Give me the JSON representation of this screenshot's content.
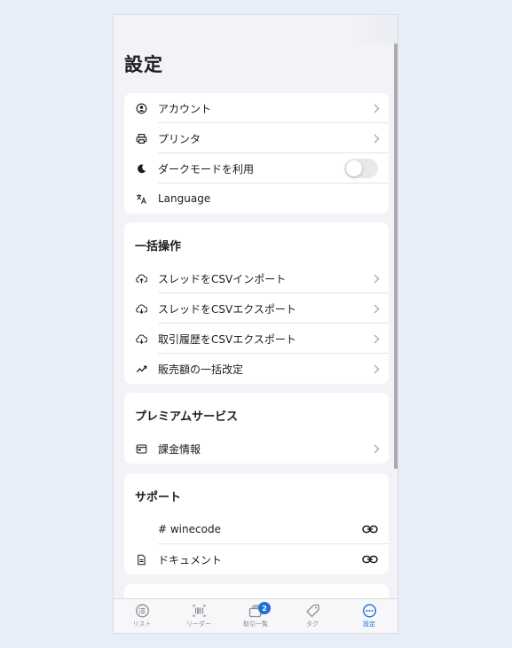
{
  "page": {
    "title": "設定"
  },
  "colors": {
    "accent": "#1f6fd6",
    "background": "#f2f2f7",
    "card": "#ffffff"
  },
  "general": {
    "items": [
      {
        "label": "アカウント",
        "icon": "account-circle-icon",
        "trailing": "chevron"
      },
      {
        "label": "プリンタ",
        "icon": "printer-icon",
        "trailing": "chevron"
      },
      {
        "label": "ダークモードを利用",
        "icon": "moon-icon",
        "trailing": "toggle",
        "toggle_on": false
      },
      {
        "label": "Language",
        "icon": "translate-icon",
        "trailing": "none"
      }
    ]
  },
  "bulk": {
    "header": "一括操作",
    "items": [
      {
        "label": "スレッドをCSVインポート",
        "icon": "cloud-upload-icon"
      },
      {
        "label": "スレッドをCSVエクスポート",
        "icon": "cloud-download-icon"
      },
      {
        "label": "取引履歴をCSVエクスポート",
        "icon": "cloud-download-icon"
      },
      {
        "label": "販売額の一括改定",
        "icon": "trending-icon"
      }
    ]
  },
  "premium": {
    "header": "プレミアムサービス",
    "items": [
      {
        "label": "課金情報",
        "icon": "billing-icon"
      }
    ]
  },
  "support": {
    "header": "サポート",
    "items": [
      {
        "label": "# winecode",
        "icon": "",
        "trailing": "link"
      },
      {
        "label": "ドキュメント",
        "icon": "document-icon",
        "trailing": "link"
      }
    ]
  },
  "tabbar": {
    "tabs": [
      {
        "label": "リスト",
        "icon": "list-icon",
        "active": false
      },
      {
        "label": "リーダー",
        "icon": "barcode-icon",
        "active": false
      },
      {
        "label": "取引一覧",
        "icon": "stack-icon",
        "active": false,
        "badge": "2"
      },
      {
        "label": "タグ",
        "icon": "tag-icon",
        "active": false
      },
      {
        "label": "設定",
        "icon": "more-icon",
        "active": true
      }
    ]
  }
}
